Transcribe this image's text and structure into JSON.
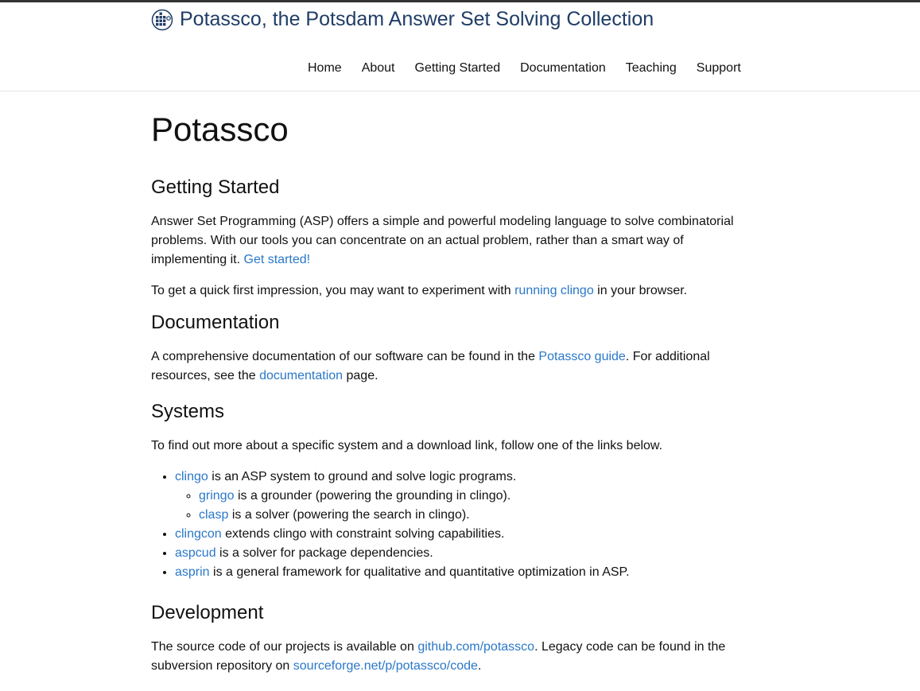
{
  "site": {
    "title": "Potassco, the Potsdam Answer Set Solving Collection",
    "logo_icon": "potassco-logo-icon"
  },
  "nav": {
    "items": [
      "Home",
      "About",
      "Getting Started",
      "Documentation",
      "Teaching",
      "Support"
    ]
  },
  "page": {
    "heading": "Potassco",
    "getting_started": {
      "heading": "Getting Started",
      "p1_text": "Answer Set Programming (ASP) offers a simple and powerful modeling language to solve combinatorial problems. With our tools you can concentrate on an actual problem, rather than a smart way of implementing it.",
      "p1_link": "Get started!",
      "p2_before": "To get a quick first impression, you may want to experiment with",
      "p2_link": "running clingo",
      "p2_after": "in your browser."
    },
    "documentation": {
      "heading": "Documentation",
      "p_before": "A comprehensive documentation of our software can be found in the",
      "p_link1": "Potassco guide",
      "p_middle": ". For additional resources, see the",
      "p_link2": "documentation",
      "p_after": "page."
    },
    "systems": {
      "heading": "Systems",
      "intro": "To find out more about a specific system and a download link, follow one of the links below.",
      "items": [
        {
          "name": "clingo",
          "desc": "is an ASP system to ground and solve logic programs."
        },
        {
          "name": "gringo",
          "desc": "is a grounder (powering the grounding in clingo)."
        },
        {
          "name": "clasp",
          "desc": "is a solver (powering the search in clingo)."
        },
        {
          "name": "clingcon",
          "desc": "extends clingo with constraint solving capabilities."
        },
        {
          "name": "aspcud",
          "desc": "is a solver for package dependencies."
        },
        {
          "name": "asprin",
          "desc": "is a general framework for qualitative and quantitative optimization in ASP."
        }
      ]
    },
    "development": {
      "heading": "Development",
      "p_before": "The source code of our projects is available on",
      "p_link1": "github.com/potassco",
      "p_middle": ". Legacy code can be found in the subversion repository on",
      "p_link2": "sourceforge.net/p/potassco/code",
      "p_after": "."
    }
  },
  "colors": {
    "link": "#2a78c8",
    "brand": "#1f3d66",
    "topbar": "#333333"
  }
}
